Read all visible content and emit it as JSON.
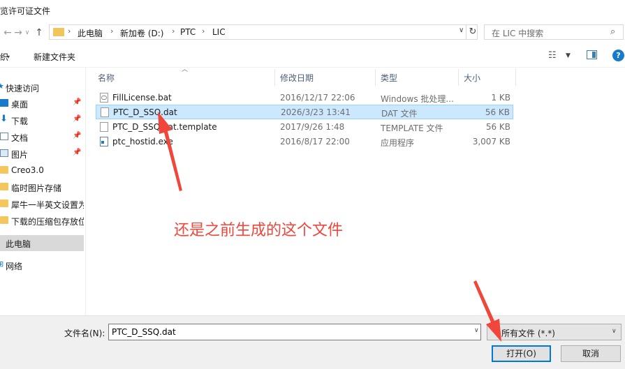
{
  "window": {
    "title": "浏览许可证文件"
  },
  "address": {
    "crumbs": [
      "此电脑",
      "新加卷 (D:)",
      "PTC",
      "LIC"
    ],
    "search_placeholder": "在 LIC 中搜索"
  },
  "toolbar": {
    "organize_label": "组织",
    "new_folder_label": "新建文件夹"
  },
  "sidebar": {
    "items": [
      {
        "label": "快速访问"
      },
      {
        "label": "桌面"
      },
      {
        "label": "下载"
      },
      {
        "label": "文档"
      },
      {
        "label": "图片"
      },
      {
        "label": "Creo3.0"
      },
      {
        "label": "临时图片存储"
      },
      {
        "label": "犀牛一半英文设置为"
      },
      {
        "label": "下载的压缩包存放位"
      },
      {
        "label": "此电脑"
      },
      {
        "label": "网络"
      }
    ]
  },
  "columns": {
    "name": "名称",
    "date": "修改日期",
    "type": "类型",
    "size": "大小"
  },
  "files": [
    {
      "name": "FillLicense.bat",
      "date": "2016/12/17 22:06",
      "type": "Windows 批处理...",
      "size": "1 KB"
    },
    {
      "name": "PTC_D_SSQ.dat",
      "date": "2026/3/23 13:41",
      "type": "DAT 文件",
      "size": "56 KB"
    },
    {
      "name": "PTC_D_SSQ.dat.template",
      "date": "2017/9/26 1:48",
      "type": "TEMPLATE 文件",
      "size": "56 KB"
    },
    {
      "name": "ptc_hostid.exe",
      "date": "2016/8/17 22:00",
      "type": "应用程序",
      "size": "3,007 KB"
    }
  ],
  "annotation": {
    "text": "还是之前生成的这个文件",
    "color": "#f0463b"
  },
  "bottom": {
    "filename_label": "文件名(N):",
    "filename_value": "PTC_D_SSQ.dat",
    "filetype_label": "所有文件 (*.*)",
    "open_label": "打开(O)",
    "cancel_label": "取消"
  },
  "colors": {
    "accent": "#0078d7",
    "selection": "#cce8ff"
  }
}
